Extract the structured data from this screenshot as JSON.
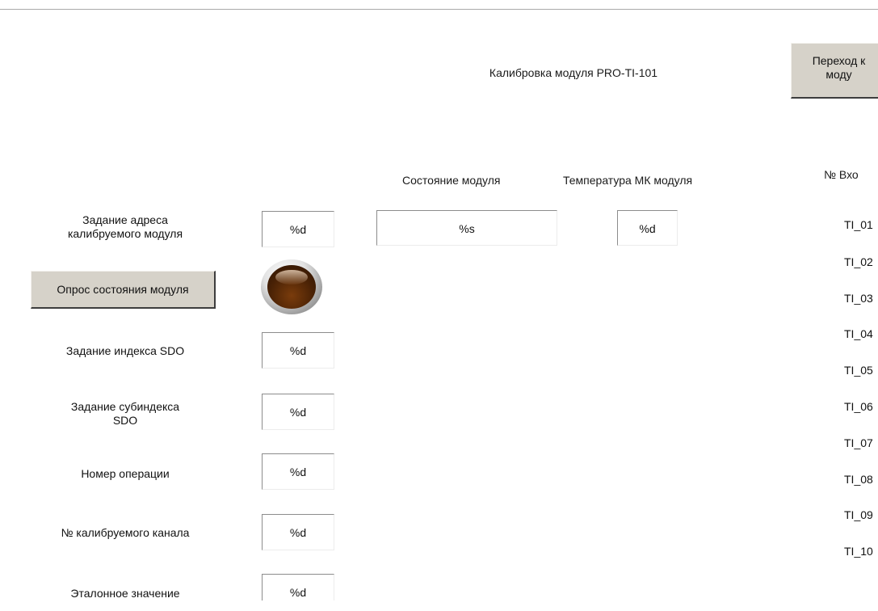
{
  "header": {
    "title": "Калибровка модуля PRO-TI-101",
    "nav_button_label": "Переход к\nмоду"
  },
  "columns": {
    "module_state": "Состояние модуля",
    "mk_temperature": "Температура МК модуля",
    "input_number": "№ Вхо"
  },
  "form": {
    "address_label": "Задание адреса\nкалибруемого модуля",
    "address_value": "%d",
    "module_state_value": "%s",
    "mk_temperature_value": "%d",
    "poll_button_label": "Опрос состояния модуля",
    "sdo_index_label": "Задание индекса SDO",
    "sdo_index_value": "%d",
    "sdo_subindex_label": "Задание субиндекса\nSDO",
    "sdo_subindex_value": "%d",
    "operation_label": "Номер операции",
    "operation_value": "%d",
    "channel_label": "№ калибруемого канала",
    "channel_value": "%d",
    "reference_label": "Эталонное значение",
    "reference_value": "%d"
  },
  "status_lamp": {
    "color": "#5a2a06"
  },
  "inputs_list": [
    "TI_01",
    "TI_02",
    "TI_03",
    "TI_04",
    "TI_05",
    "TI_06",
    "TI_07",
    "TI_08",
    "TI_09",
    "TI_10"
  ]
}
